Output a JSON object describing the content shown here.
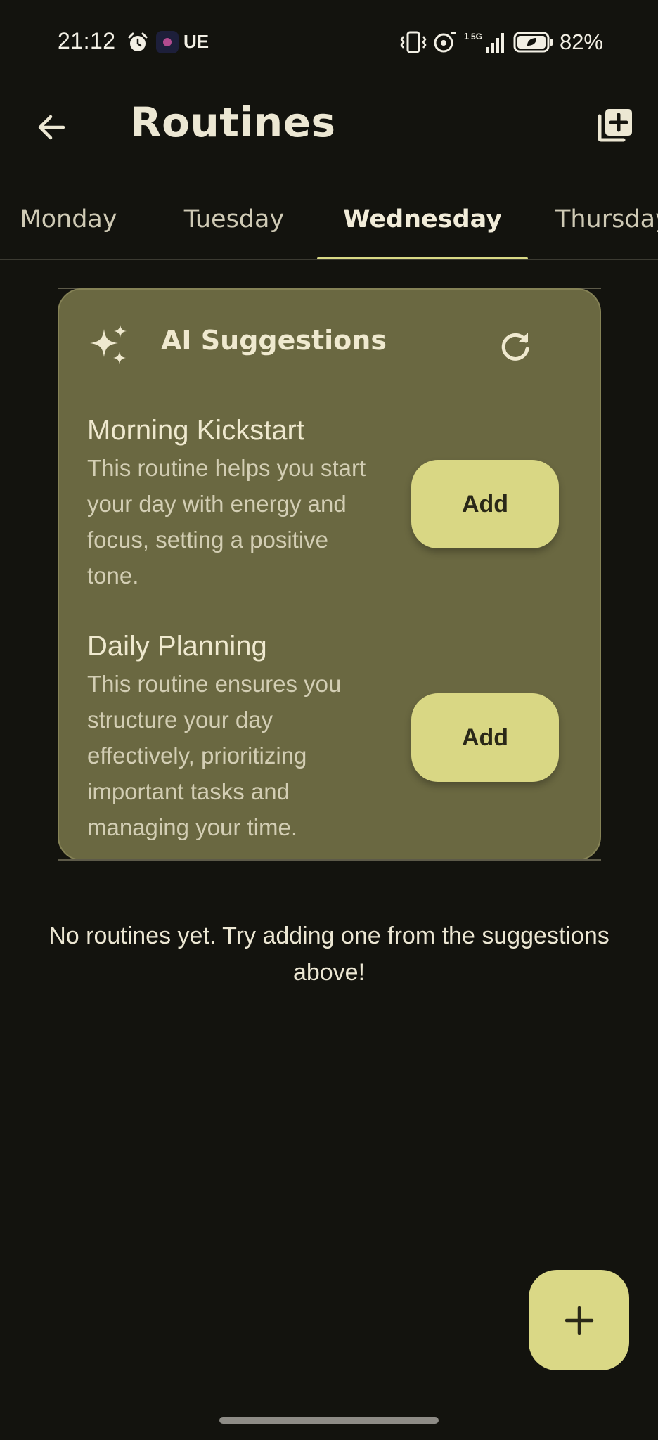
{
  "status_bar": {
    "time": "21:12",
    "carrier_label": "UE",
    "network_label": "5G",
    "battery_percent": "82%"
  },
  "app_bar": {
    "title": "Routines",
    "back_icon": "arrow-back-icon",
    "action_icon": "library-add-icon"
  },
  "tabs": [
    {
      "label": "Monday",
      "active": false
    },
    {
      "label": "Tuesday",
      "active": false
    },
    {
      "label": "Wednesday",
      "active": true
    },
    {
      "label": "Thursday",
      "active": false
    }
  ],
  "suggestions": {
    "title": "AI Suggestions",
    "icon": "sparkle-icon",
    "refresh_icon": "refresh-icon",
    "items": [
      {
        "title": "Morning Kickstart",
        "description": "This routine helps you start your day with energy and focus, setting a positive tone.",
        "button_label": "Add"
      },
      {
        "title": "Daily Planning",
        "description": "This routine ensures you structure your day effectively, prioritizing important tasks and managing your time.",
        "button_label": "Add"
      }
    ]
  },
  "empty_state": {
    "message": "No routines yet. Try adding one from the suggestions above!"
  },
  "fab": {
    "icon": "plus-icon"
  },
  "colors": {
    "background": "#13130e",
    "card": "#6a6841",
    "accent": "#d9d784",
    "text": "#ece7d3"
  }
}
